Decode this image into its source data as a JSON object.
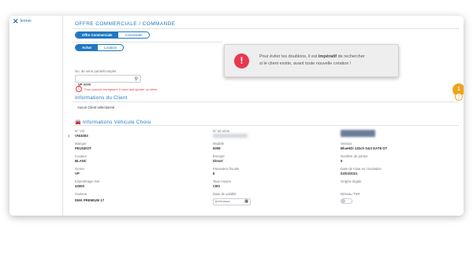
{
  "sidebar": {
    "close_label": "fermer"
  },
  "header": {
    "title": "OFFRE COMMERCIALE / COMMANDE"
  },
  "mode_tabs": [
    {
      "label": "Offre Commerciale",
      "active": true
    },
    {
      "label": "Commande",
      "active": false
    }
  ],
  "action_tabs": [
    {
      "label": "Achat",
      "active": true
    },
    {
      "label": "Location",
      "active": false
    }
  ],
  "search": {
    "label": "No. de série partiel/complet",
    "value": "VF ####",
    "warning": "Pour pouvoir enregistrer il vous faut ajouter un client"
  },
  "toast": {
    "line1_pre": "Pour éviter les doublons, il est ",
    "line1_bold": "impératif",
    "line1_post": " de rechercher",
    "line2": "si le client existe, avant toute nouvelle création !"
  },
  "badge_count": "1",
  "client_section": {
    "title": "Informations du Client",
    "empty_text": "Aucun Client sélectionné"
  },
  "vehicle_section": {
    "title": "Informations Véhicule Choisi"
  },
  "vehicle_fields": {
    "col1": [
      {
        "label": "N° VO",
        "value": "VN/4083"
      },
      {
        "label": "Marque",
        "value": "PEUGEOT"
      },
      {
        "label": "Couleur",
        "value": "BLANC"
      },
      {
        "label": "Genre",
        "value": "VP"
      },
      {
        "label": "Kilométrage réel",
        "value": "43000"
      },
      {
        "label": "Gamme",
        "value": "DMA PREMIUM 17"
      }
    ],
    "col2": [
      {
        "label": "N° de série",
        "value": ""
      },
      {
        "label": "Modèle",
        "value": "5008"
      },
      {
        "label": "Énergie",
        "value": "Diesel"
      },
      {
        "label": "Puissance fiscale",
        "value": "8"
      },
      {
        "label": "Taux moyen",
        "value": "CBS"
      },
      {
        "label": "Date de validité",
        "value": ""
      }
    ],
    "col3": [
      {
        "label": "",
        "value": ""
      },
      {
        "label": "Version",
        "value": "BlueHDi 130ch S&S EAT8 GT"
      },
      {
        "label": "Nombre de portes",
        "value": "5"
      },
      {
        "label": "Date de mise en circulation",
        "value": "03/03/2021"
      },
      {
        "label": "Origine légale",
        "value": ""
      },
      {
        "label": "Réseau TSR",
        "value": ""
      }
    ]
  },
  "date_placeholder": "jj/mm/aaaa",
  "colors": {
    "accent": "#1f78c1",
    "alert": "#e8384f",
    "badge": "#f0a21c"
  },
  "icons": [
    "close-icon",
    "search-icon",
    "alert-icon",
    "kebab-icon",
    "chevron-left-icon",
    "car-icon",
    "calendar-icon"
  ]
}
